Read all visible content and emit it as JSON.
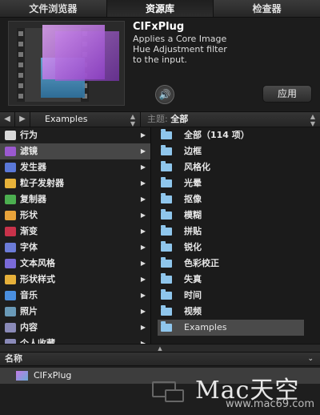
{
  "tabs": [
    {
      "label": "文件浏览器",
      "active": false
    },
    {
      "label": "资源库",
      "active": true
    },
    {
      "label": "检查器",
      "active": false
    }
  ],
  "preview": {
    "title": "CIFxPlug",
    "description": "Applies a Core Image\nHue Adjustment filter\nto the input.",
    "speaker_icon": "speaker-icon",
    "apply_label": "应用"
  },
  "nav": {
    "back_icon": "arrow-left-icon",
    "forward_icon": "arrow-right-icon",
    "location": "Examples",
    "theme_label": "主题:",
    "theme_value": "全部"
  },
  "categories": [
    {
      "label": "行为",
      "icon": "gear-icon",
      "color": "#d8d8d8",
      "selected": false
    },
    {
      "label": "滤镜",
      "icon": "filter-icon",
      "color": "#9b59d0",
      "selected": true
    },
    {
      "label": "发生器",
      "icon": "generator-icon",
      "color": "#5a78d8",
      "selected": false
    },
    {
      "label": "粒子发射器",
      "icon": "particle-icon",
      "color": "#e7b23a",
      "selected": false
    },
    {
      "label": "复制器",
      "icon": "replicator-icon",
      "color": "#4caf50",
      "selected": false
    },
    {
      "label": "形状",
      "icon": "shape-icon",
      "color": "#e8a33a",
      "selected": false
    },
    {
      "label": "渐变",
      "icon": "gradient-icon",
      "color": "#c8324a",
      "selected": false
    },
    {
      "label": "字体",
      "icon": "font-icon",
      "color": "#6c7cd8",
      "selected": false
    },
    {
      "label": "文本风格",
      "icon": "text-style-icon",
      "color": "#7a6ad8",
      "selected": false
    },
    {
      "label": "形状样式",
      "icon": "shape-style-icon",
      "color": "#e6b03a",
      "selected": false
    },
    {
      "label": "音乐",
      "icon": "music-icon",
      "color": "#4a8fe0",
      "selected": false
    },
    {
      "label": "照片",
      "icon": "photo-icon",
      "color": "#6a9ab8",
      "selected": false
    },
    {
      "label": "内容",
      "icon": "content-icon",
      "color": "#8a8ab8",
      "selected": false
    },
    {
      "label": "个人收藏",
      "icon": "favorites-icon",
      "color": "#8a8ab8",
      "selected": false
    }
  ],
  "folders": [
    {
      "label": "全部（114 项）",
      "selected": false
    },
    {
      "label": "边框",
      "selected": false
    },
    {
      "label": "风格化",
      "selected": false
    },
    {
      "label": "光晕",
      "selected": false
    },
    {
      "label": "抠像",
      "selected": false
    },
    {
      "label": "模糊",
      "selected": false
    },
    {
      "label": "拼贴",
      "selected": false
    },
    {
      "label": "锐化",
      "selected": false
    },
    {
      "label": "色彩校正",
      "selected": false
    },
    {
      "label": "失真",
      "selected": false
    },
    {
      "label": "时间",
      "selected": false
    },
    {
      "label": "视频",
      "selected": false
    },
    {
      "label": "Examples",
      "selected": true
    }
  ],
  "bottom": {
    "header": "名称",
    "row_label": "CIFxPlug"
  },
  "watermark": {
    "title": "Mac天空",
    "url": "www.mac69.com"
  }
}
